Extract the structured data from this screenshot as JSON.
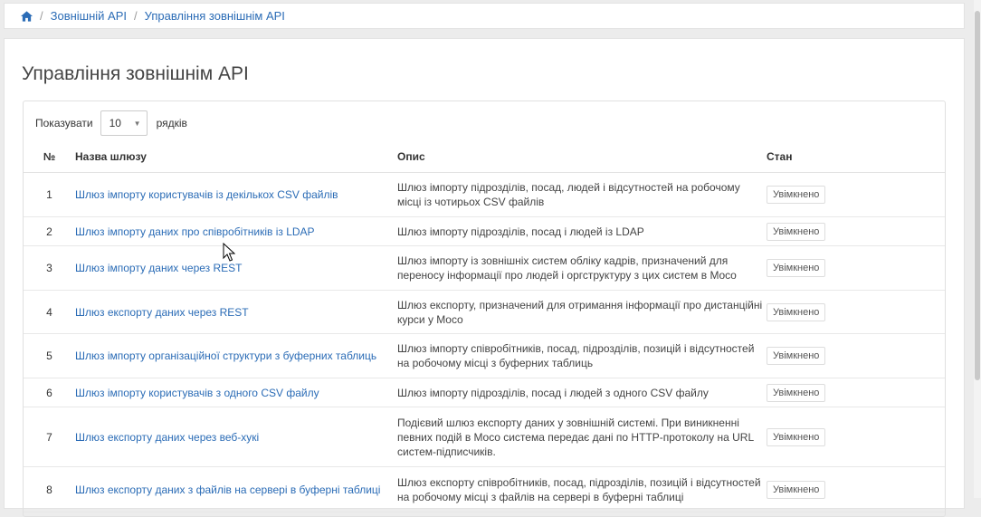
{
  "breadcrumb": {
    "home_icon": "home-icon",
    "items": [
      "Зовнішній API",
      "Управління зовнішнім API"
    ]
  },
  "page": {
    "title": "Управління зовнішнім API"
  },
  "length": {
    "prefix": "Показувати",
    "value": "10",
    "suffix": "рядків"
  },
  "table": {
    "headers": {
      "num": "№",
      "name": "Назва шлюзу",
      "desc": "Опис",
      "status": "Стан"
    },
    "rows": [
      {
        "num": "1",
        "name": "Шлюз імпорту користувачів із декількох CSV файлів",
        "desc": "Шлюз імпорту підрозділів, посад, людей і відсутностей на робочому місці із чотирьох CSV файлів",
        "status": "Увімкнено"
      },
      {
        "num": "2",
        "name": "Шлюз імпорту даних про співробітників із LDAP",
        "desc": "Шлюз імпорту підрозділів, посад і людей із LDAP",
        "status": "Увімкнено"
      },
      {
        "num": "3",
        "name": "Шлюз імпорту даних через REST",
        "desc": "Шлюз імпорту із зовнішніх систем обліку кадрів, призначений для переносу інформації про людей і оргструктуру з цих систем в Moco",
        "status": "Увімкнено"
      },
      {
        "num": "4",
        "name": "Шлюз експорту даних через REST",
        "desc": "Шлюз експорту, призначений для отримання інформації про дистанційні курси у Moco",
        "status": "Увімкнено"
      },
      {
        "num": "5",
        "name": "Шлюз імпорту організаційної структури з буферних таблиць",
        "desc": "Шлюз імпорту співробітників, посад, підрозділів, позицій і відсутностей на робочому місці з буферних таблиць",
        "status": "Увімкнено"
      },
      {
        "num": "6",
        "name": "Шлюз імпорту користувачів з одного CSV файлу",
        "desc": "Шлюз імпорту підрозділів, посад і людей з одного CSV файлу",
        "status": "Увімкнено"
      },
      {
        "num": "7",
        "name": "Шлюз експорту даних через веб-хукі",
        "desc": "Подієвий шлюз експорту даних у зовнішній системі. При виникненні певних подій в Moco система передає дані по HTTP-протоколу на URL систем-підписчиків.",
        "status": "Увімкнено"
      },
      {
        "num": "8",
        "name": "Шлюз експорту даних з файлів на сервері в буферні таблиці",
        "desc": "Шлюз експорту співробітників, посад, підрозділів, позицій і відсутностей на робочому місці з файлів на сервері в буферні таблиці",
        "status": "Увімкнено"
      }
    ]
  }
}
